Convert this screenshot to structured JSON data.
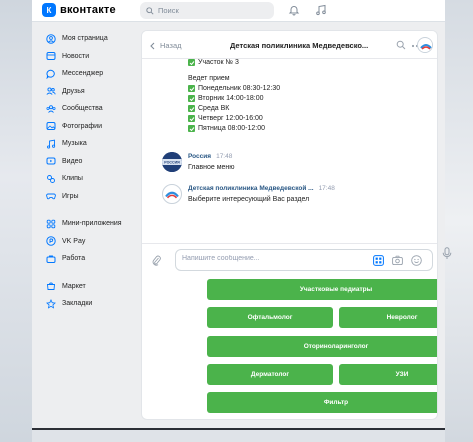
{
  "header": {
    "logo_letter": "К",
    "logo_text": "вконтакте",
    "search_placeholder": "Поиск"
  },
  "sidebar": {
    "items": [
      {
        "label": "Моя страница",
        "icon": "user-circle-icon"
      },
      {
        "label": "Новости",
        "icon": "news-icon"
      },
      {
        "label": "Мессенджер",
        "icon": "chat-bubble-icon"
      },
      {
        "label": "Друзья",
        "icon": "friends-icon"
      },
      {
        "label": "Сообщества",
        "icon": "groups-icon"
      },
      {
        "label": "Фотографии",
        "icon": "photo-icon"
      },
      {
        "label": "Музыка",
        "icon": "music-icon"
      },
      {
        "label": "Видео",
        "icon": "video-icon"
      },
      {
        "label": "Клипы",
        "icon": "clips-icon"
      },
      {
        "label": "Игры",
        "icon": "games-icon"
      }
    ],
    "items2": [
      {
        "label": "Мини-приложения",
        "icon": "apps-icon"
      },
      {
        "label": "VK Pay",
        "icon": "vkpay-icon"
      },
      {
        "label": "Работа",
        "icon": "briefcase-icon"
      }
    ],
    "items3": [
      {
        "label": "Маркет",
        "icon": "bag-icon"
      },
      {
        "label": "Закладки",
        "icon": "star-icon"
      }
    ]
  },
  "chat": {
    "back_label": "Назад",
    "title": "Детская поликлиника Медведевско..."
  },
  "messages": {
    "partial_line": "Участок № 3",
    "reception_title": "Ведет прием",
    "schedule": [
      "Понедельник 08:30-12:30",
      "Вторник 14:00-18:00",
      "Среда ВК",
      "Четверг 12:00-16:00",
      "Пятница 08:00-12:00"
    ],
    "msg2_sender": "Россия",
    "msg2_time": "17:48",
    "msg2_text": "Главное меню",
    "msg3_sender": "Детская поликлиника Медведевской ...",
    "msg3_time": "17:48",
    "msg3_text": "Выберите интересующий Вас раздел",
    "avatar_label": "РОССИЯ"
  },
  "composer": {
    "placeholder": "Напишите сообщение..."
  },
  "keyboard": {
    "btn1": "Участковые педиатры",
    "btn2": "Офтальмолог",
    "btn3": "Невролог",
    "btn4": "Оториноларинголог",
    "btn5": "Дерматолог",
    "btn6": "УЗИ",
    "btn7": "Фильтр"
  },
  "colors": {
    "vk_blue": "#0077ff",
    "button_green": "#4bb34b",
    "link_blue": "#2a5885"
  }
}
